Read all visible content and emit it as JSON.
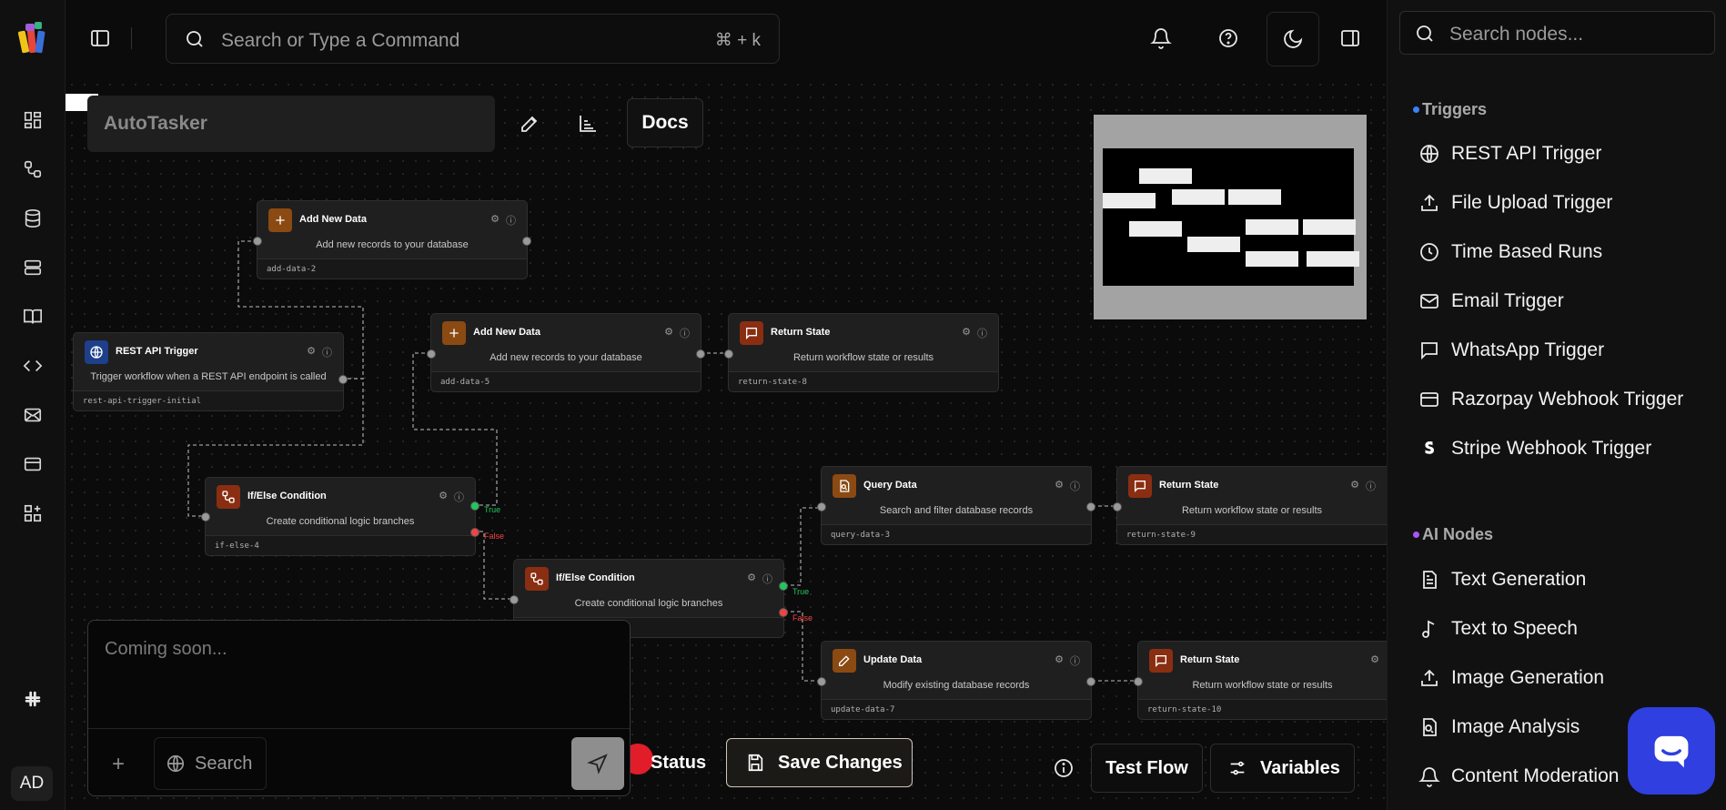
{
  "topbar": {
    "search_placeholder": "Search or Type a Command",
    "shortcut": "⌘ + k"
  },
  "rail": {
    "avatar_initials": "AD"
  },
  "workflow": {
    "name_placeholder": "AutoTasker",
    "docs_label": "Docs"
  },
  "nodes": [
    {
      "title": "Add New Data",
      "description": "Add new records to your database",
      "id": "add-data-2",
      "icon": "plus-icon",
      "color": "#8a4a12"
    },
    {
      "title": "REST API Trigger",
      "description": "Trigger workflow when a REST API endpoint is called",
      "id": "rest-api-trigger-initial",
      "icon": "globe-icon",
      "color": "#1e3f8a"
    },
    {
      "title": "Add New Data",
      "description": "Add new records to your database",
      "id": "add-data-5",
      "icon": "plus-icon",
      "color": "#8a4a12"
    },
    {
      "title": "Return State",
      "description": "Return workflow state or results",
      "id": "return-state-8",
      "icon": "message-icon",
      "color": "#8a2e12"
    },
    {
      "title": "If/Else Condition",
      "description": "Create conditional logic branches",
      "id": "if-else-4",
      "icon": "branch-icon",
      "color": "#8a2e12"
    },
    {
      "title": "If/Else Condition",
      "description": "Create conditional logic branches",
      "id": "",
      "icon": "branch-icon",
      "color": "#8a2e12"
    },
    {
      "title": "Query Data",
      "description": "Search and filter database records",
      "id": "query-data-3",
      "icon": "query-icon",
      "color": "#8a4a12"
    },
    {
      "title": "Return State",
      "description": "Return workflow state or results",
      "id": "return-state-9",
      "icon": "message-icon",
      "color": "#8a2e12"
    },
    {
      "title": "Update Data",
      "description": "Modify existing database records",
      "id": "update-data-7",
      "icon": "pencil-icon",
      "color": "#8a4a12"
    },
    {
      "title": "Return State",
      "description": "Return workflow state or results",
      "id": "return-state-10",
      "icon": "message-icon",
      "color": "#8a2e12"
    }
  ],
  "edge_labels": {
    "true": "True",
    "false": "False"
  },
  "chat": {
    "placeholder": "Coming soon...",
    "search_label": "Search"
  },
  "actions": {
    "status_label": "Status",
    "save_label": "Save Changes",
    "test_label": "Test Flow",
    "variables_label": "Variables"
  },
  "panel": {
    "search_placeholder": "Search nodes...",
    "sections": [
      {
        "title": "Triggers",
        "dot_color": "#3b82f6",
        "items": [
          {
            "label": "REST API Trigger",
            "icon": "globe-icon"
          },
          {
            "label": "File Upload Trigger",
            "icon": "upload-icon"
          },
          {
            "label": "Time Based Runs",
            "icon": "clock-icon"
          },
          {
            "label": "Email Trigger",
            "icon": "mail-icon"
          },
          {
            "label": "WhatsApp Trigger",
            "icon": "chat-icon"
          },
          {
            "label": "Razorpay Webhook Trigger",
            "icon": "card-icon"
          },
          {
            "label": "Stripe Webhook Trigger",
            "icon": "stripe-icon"
          }
        ]
      },
      {
        "title": "AI Nodes",
        "dot_color": "#a855f7",
        "items": [
          {
            "label": "Text Generation",
            "icon": "document-icon"
          },
          {
            "label": "Text to Speech",
            "icon": "music-icon"
          },
          {
            "label": "Image Generation",
            "icon": "upload-icon"
          },
          {
            "label": "Image Analysis",
            "icon": "image-search-icon"
          },
          {
            "label": "Content Moderation",
            "icon": "bell-alert-icon"
          }
        ]
      }
    ]
  },
  "colors": {
    "accent_blue": "#2f3fe0",
    "status_red": "#e11d2a",
    "true_green": "#22c55e",
    "false_red": "#ef4444"
  }
}
